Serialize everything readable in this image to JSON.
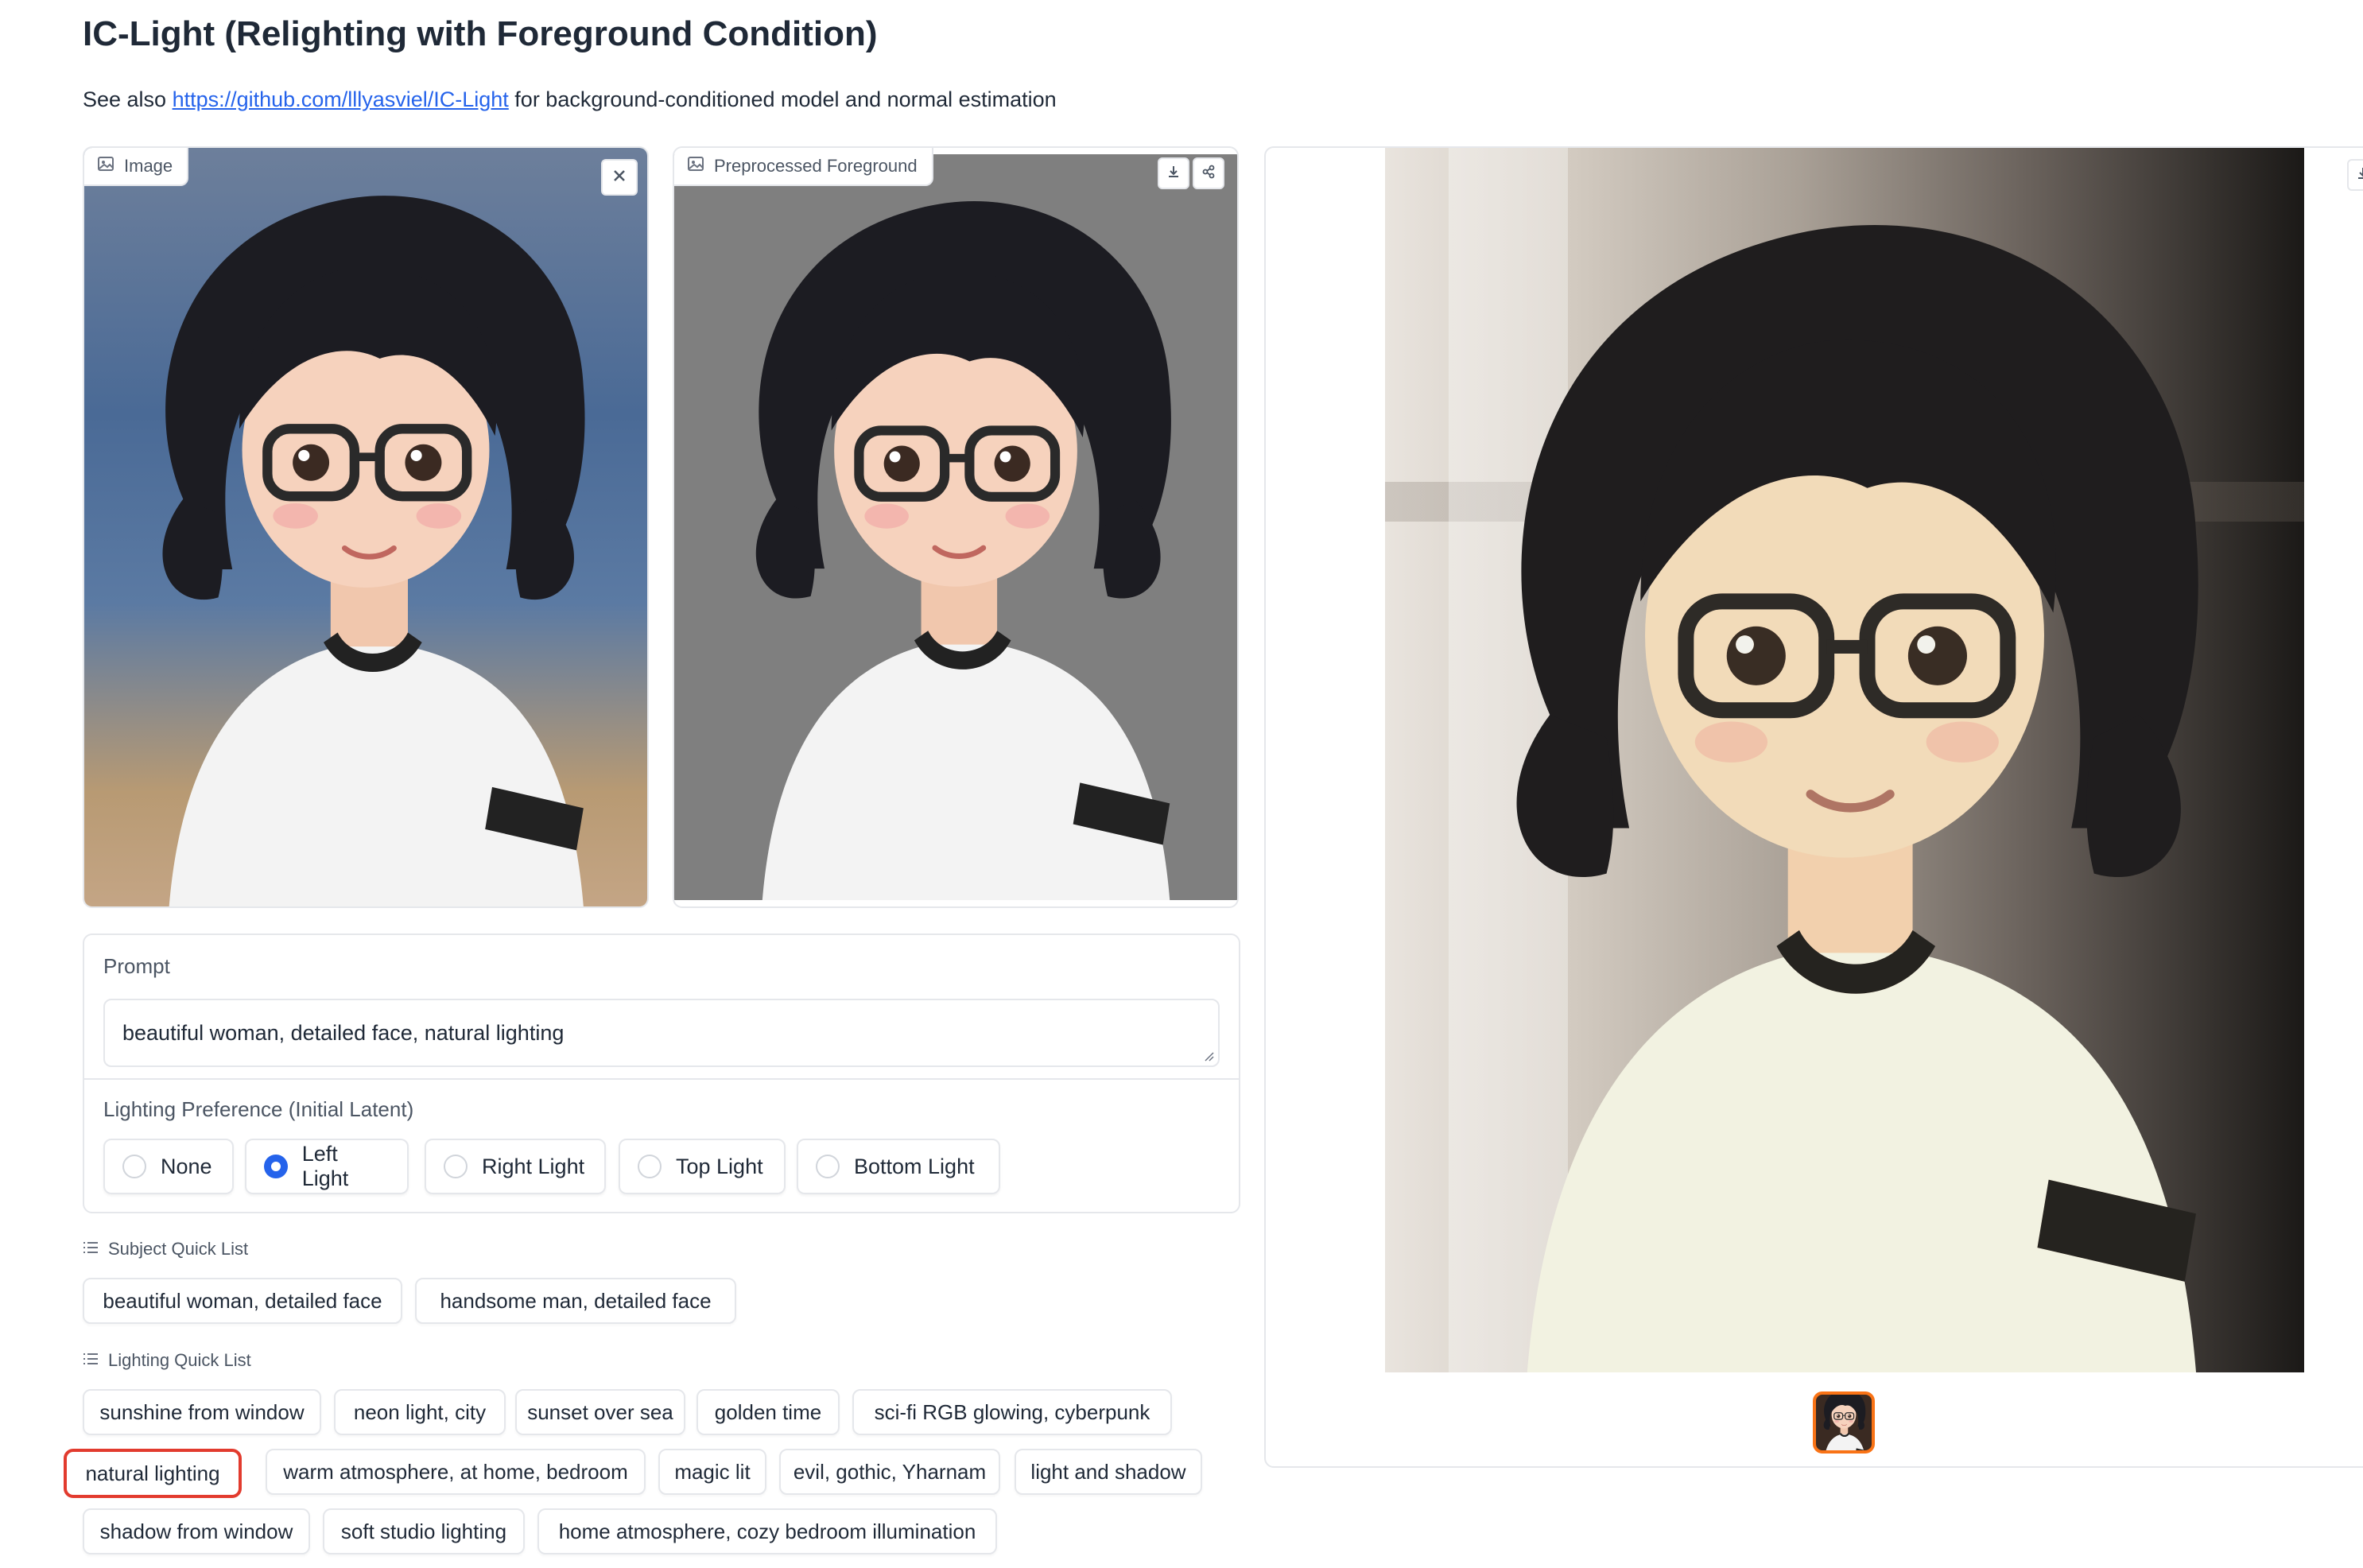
{
  "page": {
    "title": "IC-Light (Relighting with Foreground Condition)",
    "subtitle_prefix": "See also",
    "subtitle_link": "https://github.com/lllyasviel/IC-Light",
    "subtitle_suffix": "for background-conditioned model and normal estimation"
  },
  "image_input": {
    "label": "Image",
    "icon": "image-icon",
    "close_icon": "close-icon"
  },
  "preprocessed": {
    "label": "Preprocessed Foreground",
    "icon": "image-icon",
    "download_icon": "download-icon",
    "share_icon": "share-icon"
  },
  "result": {
    "download_icon": "download-icon"
  },
  "prompt": {
    "label": "Prompt",
    "value": "beautiful woman, detailed face, natural lighting"
  },
  "lighting_preference": {
    "label": "Lighting Preference (Initial Latent)",
    "options": [
      "None",
      "Left Light",
      "Right Light",
      "Top Light",
      "Bottom Light"
    ],
    "selected": "Left Light"
  },
  "subject_quick_list": {
    "label": "Subject Quick List",
    "items": [
      "beautiful woman, detailed face",
      "handsome man, detailed face"
    ]
  },
  "lighting_quick_list": {
    "label": "Lighting Quick List",
    "items": [
      "sunshine from window",
      "neon light, city",
      "sunset over sea",
      "golden time",
      "sci-fi RGB glowing, cyberpunk",
      "natural lighting",
      "warm atmosphere, at home, bedroom",
      "magic lit",
      "evil, gothic, Yharnam",
      "light and shadow",
      "shadow from window",
      "soft studio lighting",
      "home atmosphere, cozy bedroom illumination"
    ],
    "highlighted": "natural lighting"
  },
  "colors": {
    "accent": "#2563eb",
    "highlight_box": "#e23b2e",
    "thumb_border": "#f97316"
  }
}
